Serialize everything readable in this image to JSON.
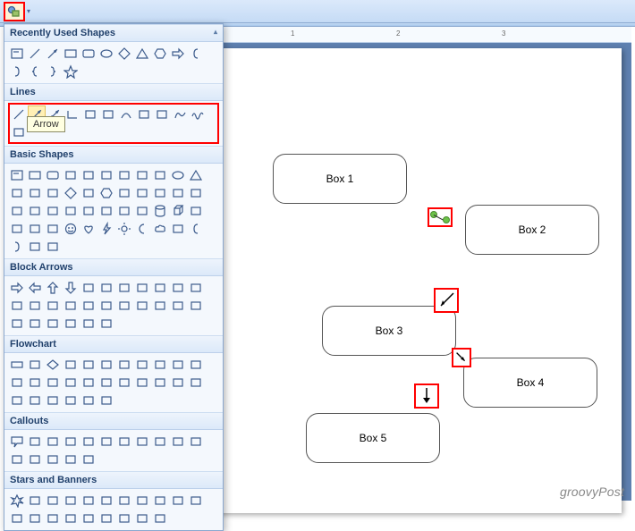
{
  "qat": {
    "shapes_dropdown": "Shapes"
  },
  "tooltip": "Arrow",
  "panel": {
    "sections": {
      "recent": "Recently Used Shapes",
      "lines": "Lines",
      "basic": "Basic Shapes",
      "block": "Block Arrows",
      "flow": "Flowchart",
      "callouts": "Callouts",
      "stars": "Stars and Banners"
    }
  },
  "ruler": {
    "marks": [
      "1",
      "2",
      "3"
    ]
  },
  "boxes": {
    "b1": "Box 1",
    "b2": "Box 2",
    "b3": "Box 3",
    "b4": "Box 4",
    "b5": "Box 5"
  },
  "watermark": "groovyPost",
  "icons": {
    "recent": [
      "textbox",
      "line",
      "arrow",
      "rect",
      "round-rect",
      "oval",
      "diamond",
      "triangle",
      "hexagon",
      "right-arrow",
      "bracket-l",
      "bracket-r",
      "lbrace",
      "rbrace",
      "star"
    ],
    "lines": [
      "line",
      "arrow",
      "dbl-arrow",
      "elbow",
      "elbow-arrow",
      "elbow-dbl",
      "curve",
      "curve-arrow",
      "curve-dbl",
      "freeform",
      "scribble",
      "scribble2"
    ],
    "basic": [
      "textbox",
      "rect",
      "round-rect",
      "snip1",
      "snip2",
      "snip-diag",
      "round1",
      "round2",
      "round-diag",
      "oval",
      "triangle",
      "rtriangle",
      "parallelogram",
      "trapezoid",
      "diamond",
      "pentagon",
      "hexagon",
      "heptagon",
      "octagon",
      "decagon",
      "dodecagon",
      "pie",
      "chord",
      "teardrop",
      "frame",
      "half-frame",
      "lshape",
      "diag-stripe",
      "cross",
      "plaque",
      "can",
      "cube",
      "bevel",
      "donut",
      "no",
      "block-arc",
      "smiley",
      "heart",
      "lightning",
      "sun",
      "moon",
      "cloud",
      "arc1",
      "bracket-l",
      "bracket-r",
      "brace-l",
      "brace-r"
    ],
    "block": [
      "right",
      "left",
      "up",
      "down",
      "leftright",
      "updown",
      "quad",
      "leftrightup",
      "bent",
      "uturn",
      "leftup",
      "bentup",
      "curvedright",
      "curvedleft",
      "curvedup",
      "curveddown",
      "striped",
      "notched",
      "pentagon2",
      "chevron",
      "rcallout",
      "dcallout",
      "lcallout",
      "ucallout",
      "lrcallout",
      "udcallout",
      "quadcallout",
      "circular"
    ],
    "flow": [
      "process",
      "alt",
      "decision",
      "data",
      "predef",
      "internal",
      "document",
      "multi",
      "terminator",
      "prep",
      "manual-in",
      "manual-op",
      "connector",
      "offpage",
      "card",
      "tape",
      "junction",
      "or",
      "collate",
      "sort",
      "extract",
      "merge",
      "stored",
      "delay",
      "seq",
      "magnetic",
      "direct",
      "display"
    ],
    "callouts": [
      "rect-co",
      "round-co",
      "oval-co",
      "cloud-co",
      "line-co1",
      "line-co2",
      "line-co3",
      "line-co4",
      "bent-co1",
      "bent-co2",
      "bent-co3",
      "bent-co4",
      "border-co1",
      "border-co2",
      "border-co3",
      "border-co4"
    ],
    "stars": [
      "explosion1",
      "explosion2",
      "star4",
      "star5",
      "star6",
      "star7",
      "star8",
      "star10",
      "star12",
      "star16",
      "star24",
      "star32",
      "ribbon-up",
      "ribbon-down",
      "ribbon2-up",
      "ribbon2-down",
      "vscroll",
      "hscroll",
      "wave",
      "dwave"
    ]
  }
}
